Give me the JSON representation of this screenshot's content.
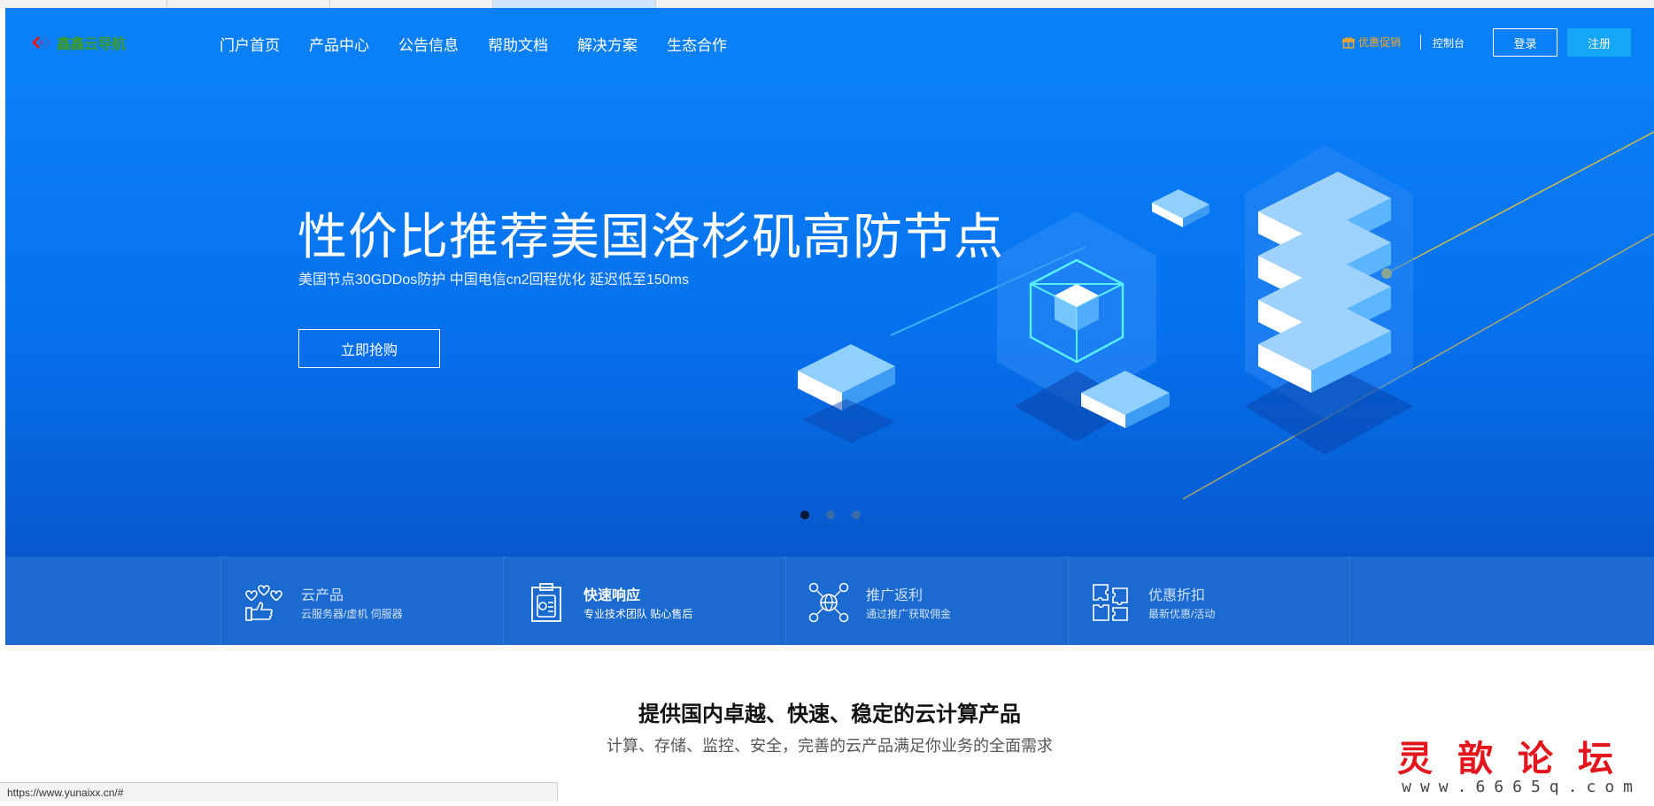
{
  "brand": {
    "logo_text": "鑫鑫云导航"
  },
  "nav": {
    "items": [
      {
        "label": "门户首页"
      },
      {
        "label": "产品中心"
      },
      {
        "label": "公告信息"
      },
      {
        "label": "帮助文档"
      },
      {
        "label": "解决方案"
      },
      {
        "label": "生态合作"
      }
    ]
  },
  "header_actions": {
    "promo_label": "优惠促销",
    "console_label": "控制台",
    "login_label": "登录",
    "register_label": "注册",
    "promo_color": "#f6a623",
    "register_color": "#16a6f6"
  },
  "banner": {
    "title": "性价比推荐美国洛杉矶高防节点",
    "subtitle": "美国节点30GDDos防护 中国电信cn2回程优化 延迟低至150ms",
    "cta_label": "立即抢购",
    "slides": 3,
    "active_slide": 1,
    "background_color": "#0a80f8"
  },
  "features": [
    {
      "title": "云产品",
      "desc": "云服务器/虚机 伺服器",
      "icon": "thumbs-up-hearts-icon"
    },
    {
      "title": "快速响应",
      "desc": "专业技术团队 贴心售后",
      "icon": "clipboard-icon"
    },
    {
      "title": "推广返利",
      "desc": "通过推广获取佣金",
      "icon": "globe-network-icon"
    },
    {
      "title": "优惠折扣",
      "desc": "最新优惠/活动",
      "icon": "puzzle-icon"
    }
  ],
  "section": {
    "title": "提供国内卓越、快速、稳定的云计算产品",
    "subtitle": "计算、存储、监控、安全，完善的云产品满足你业务的全面需求"
  },
  "status_bar": {
    "url": "https://www.yunaixx.cn/#"
  },
  "watermark": {
    "title": "灵歆论坛",
    "url": "www.6665q.com"
  }
}
